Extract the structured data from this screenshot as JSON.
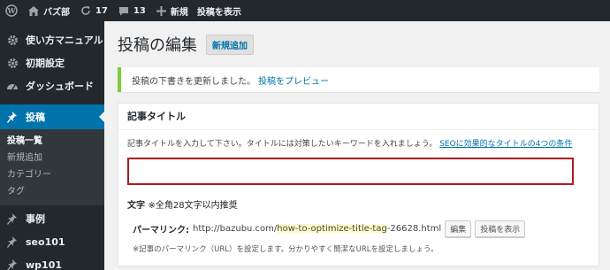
{
  "admin_bar": {
    "site_name": "バズ部",
    "updates_count": "17",
    "comments_count": "13",
    "new_label": "新規",
    "view_post_label": "投稿を表示"
  },
  "sidebar": {
    "items_top": [
      {
        "label": "使い方マニュアル",
        "icon": "gear-icon"
      },
      {
        "label": "初期設定",
        "icon": "gear-icon"
      },
      {
        "label": "ダッシュボード",
        "icon": "dashboard-icon"
      }
    ],
    "active": {
      "label": "投稿",
      "icon": "pin-icon"
    },
    "submenu": [
      "投稿一覧",
      "新規追加",
      "カテゴリー",
      "タグ"
    ],
    "items_bottom": [
      {
        "label": "事例",
        "icon": "pin-icon"
      },
      {
        "label": "seo101",
        "icon": "pin-icon"
      },
      {
        "label": "wp101",
        "icon": "pin-icon"
      }
    ]
  },
  "main": {
    "page_title": "投稿の編集",
    "add_new_label": "新規追加",
    "notice_text": "投稿の下書きを更新しました。",
    "notice_link": "投稿をプレビュー",
    "postbox": {
      "title": "記事タイトル",
      "description": "記事タイトルを入力して下さい。タイトルには対策したいキーワードを入れましょう。",
      "description_link": "SEOに効果的なタイトルの4つの条件",
      "input_value": "",
      "char_label": "文字",
      "char_note": "※全角28文字以内推奨",
      "permalink_label": "パーマリンク:",
      "permalink_base": "http://bazubu.com/",
      "permalink_slug": "how-to-optimize-title-tag",
      "permalink_suffix": "-26628.html",
      "edit_label": "編集",
      "view_label": "投稿を表示",
      "note": "※記事のパーマリンク（URL）を設定します。分かりやすく簡潔なURLを設定しましょう。"
    }
  },
  "colors": {
    "admin_bar": "#23282d",
    "active_menu": "#0073aa",
    "notice_border": "#7ad03a",
    "input_border": "#b0191e",
    "link": "#0073aa"
  }
}
